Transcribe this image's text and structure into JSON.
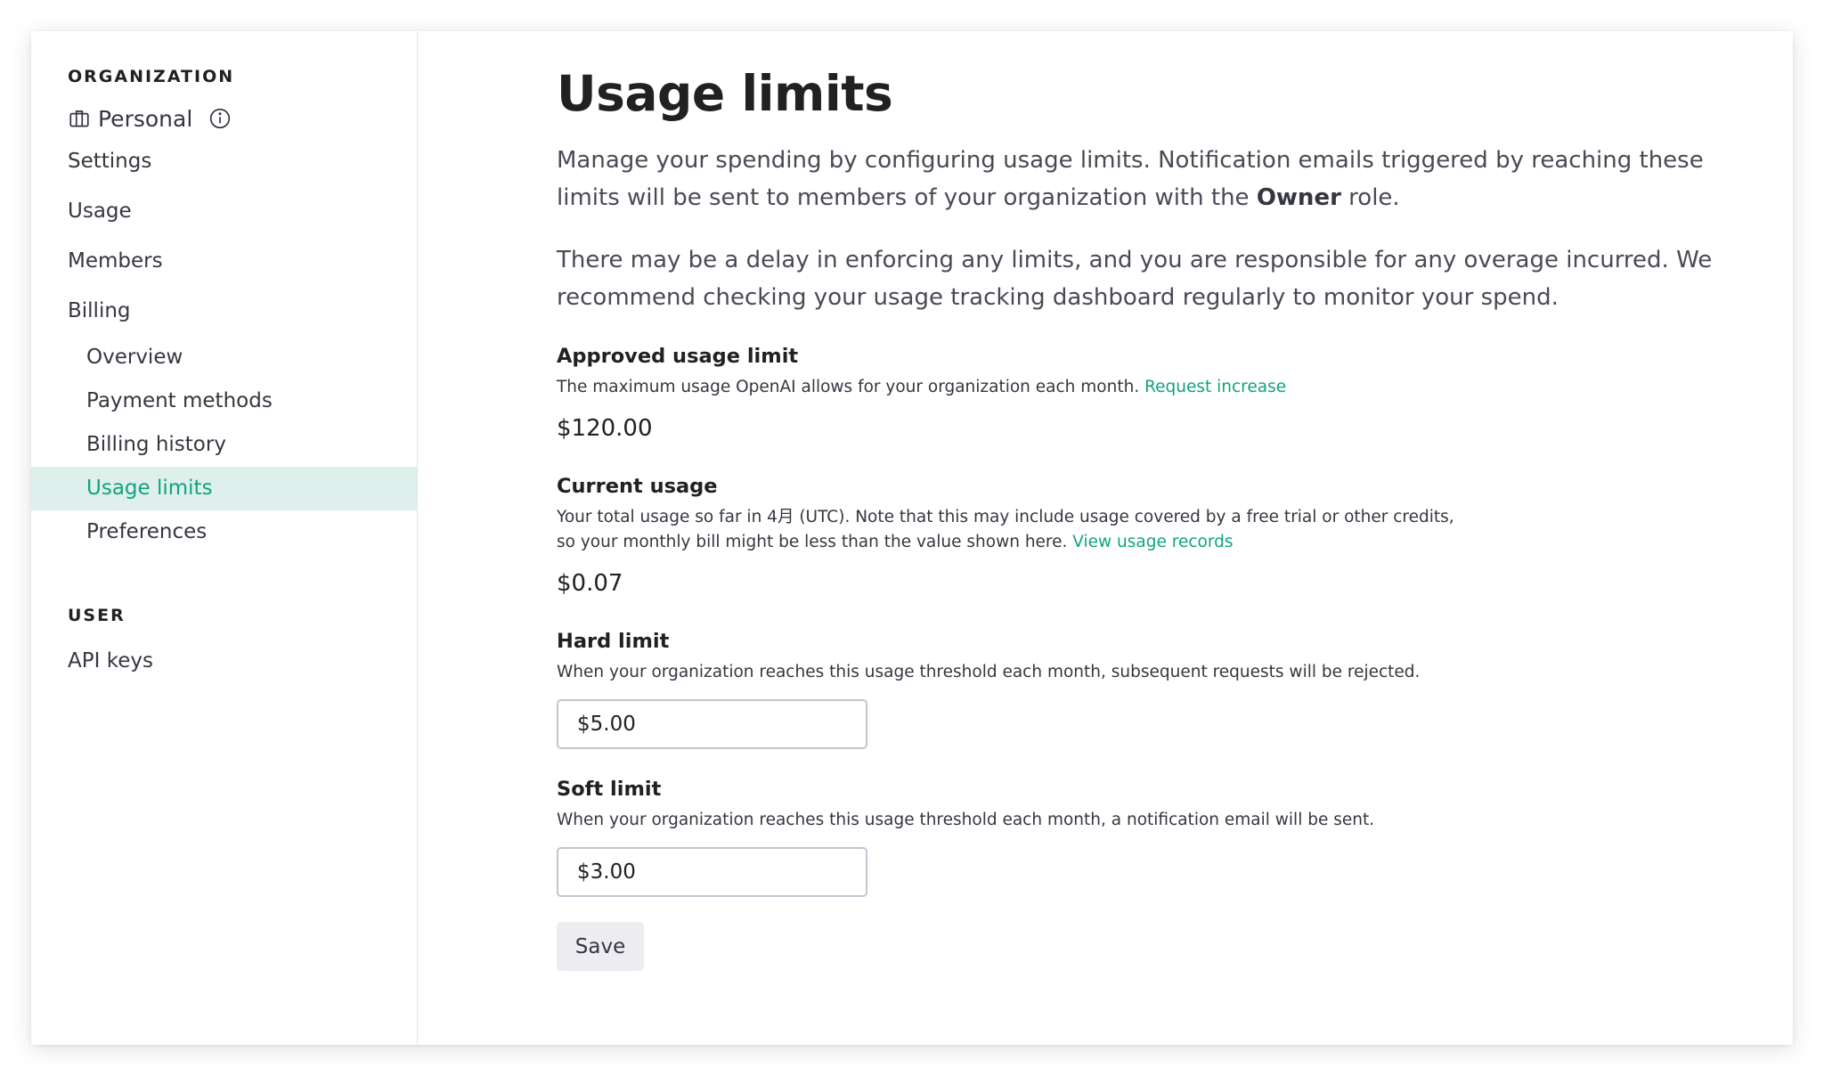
{
  "sidebar": {
    "org_heading": "ORGANIZATION",
    "org_name": "Personal",
    "items": [
      "Settings",
      "Usage",
      "Members",
      "Billing"
    ],
    "billing_items": [
      {
        "label": "Overview",
        "active": false
      },
      {
        "label": "Payment methods",
        "active": false
      },
      {
        "label": "Billing history",
        "active": false
      },
      {
        "label": "Usage limits",
        "active": true
      },
      {
        "label": "Preferences",
        "active": false
      }
    ],
    "user_heading": "USER",
    "user_items": [
      "API keys"
    ]
  },
  "main": {
    "title": "Usage limits",
    "intro1_before": "Manage your spending by configuring usage limits. Notification emails triggered by reaching these limits will be sent to members of your organization with the ",
    "intro1_bold": "Owner",
    "intro1_after": " role.",
    "intro2": "There may be a delay in enforcing any limits, and you are responsible for any overage incurred. We recommend checking your usage tracking dashboard regularly to monitor your spend.",
    "approved": {
      "label": "Approved usage limit",
      "desc": "The maximum usage OpenAI allows for your organization each month. ",
      "link": "Request increase",
      "value": "$120.00"
    },
    "current": {
      "label": "Current usage",
      "desc": "Your total usage so far in 4月 (UTC). Note that this may include usage covered by a free trial or other credits, so your monthly bill might be less than the value shown here. ",
      "link": "View usage records",
      "value": "$0.07"
    },
    "hard": {
      "label": "Hard limit",
      "desc": "When your organization reaches this usage threshold each month, subsequent requests will be rejected.",
      "value": "$5.00"
    },
    "soft": {
      "label": "Soft limit",
      "desc": "When your organization reaches this usage threshold each month, a notification email will be sent.",
      "value": "$3.00"
    },
    "save_label": "Save"
  },
  "colors": {
    "accent": "#10a37f",
    "active_bg": "#dff0ec",
    "text": "#353740"
  }
}
